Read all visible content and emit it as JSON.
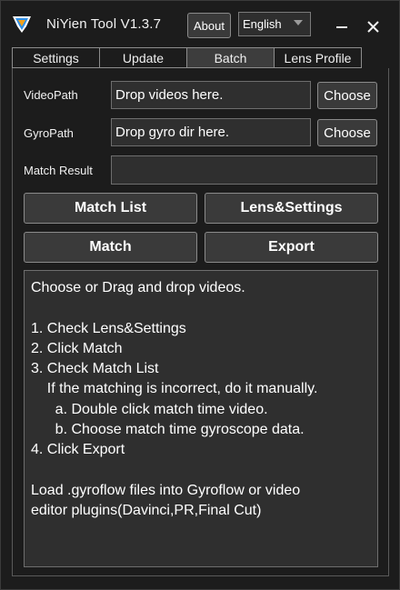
{
  "window": {
    "title": "NiYien Tool  V1.3.7",
    "about_label": "About",
    "language": "English",
    "accent_color": "#2e8fe8"
  },
  "tabs": [
    {
      "label": "Settings",
      "active": false
    },
    {
      "label": "Update",
      "active": false
    },
    {
      "label": "Batch",
      "active": true
    },
    {
      "label": "Lens Profile",
      "active": false
    }
  ],
  "form": {
    "video_path_label": "VideoPath",
    "video_path_placeholder": "Drop videos here.",
    "gyro_path_label": "GyroPath",
    "gyro_path_placeholder": "Drop gyro dir here.",
    "match_result_label": "Match Result",
    "match_result_value": "",
    "choose_label": "Choose"
  },
  "actions": {
    "match_list": "Match List",
    "lens_settings": "Lens&Settings",
    "match": "Match",
    "export": "Export"
  },
  "instructions": [
    "Choose or Drag and drop videos.",
    "",
    "1. Check Lens&Settings",
    "2. Click Match",
    "3. Check Match List",
    "    If the matching is incorrect, do it manually.",
    "      a. Double click match time video.",
    "      b. Choose match time gyroscope data.",
    "4. Click Export",
    "",
    "Load .gyroflow files into Gyroflow or video",
    "editor plugins(Davinci,PR,Final Cut)"
  ]
}
